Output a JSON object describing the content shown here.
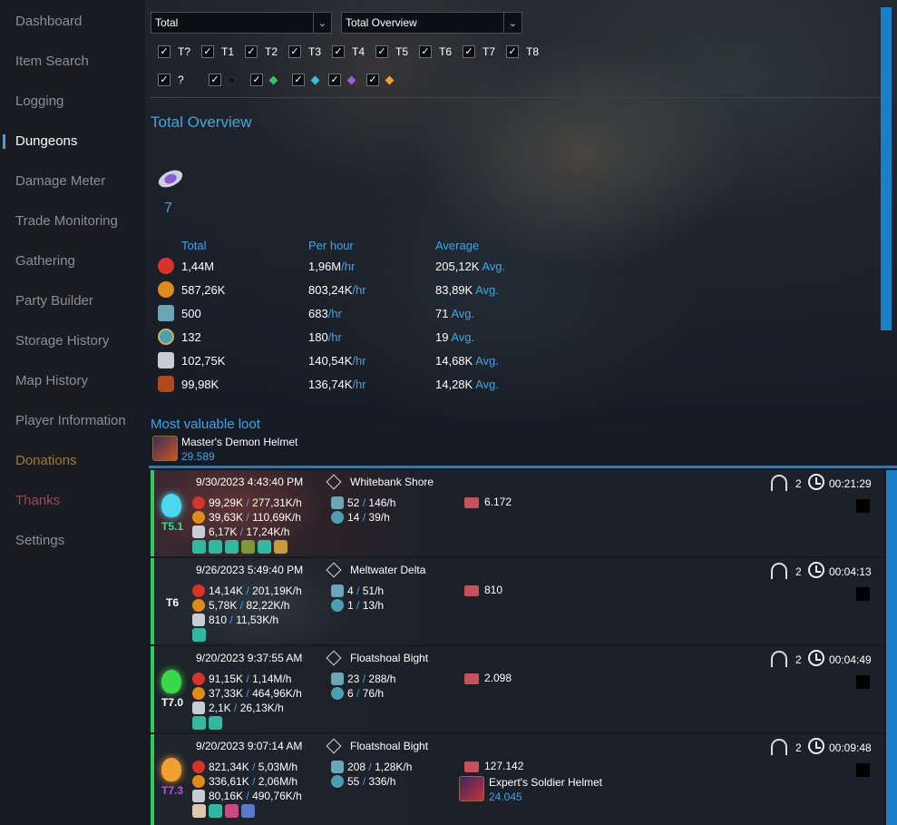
{
  "sidebar": {
    "items": [
      {
        "label": "Dashboard"
      },
      {
        "label": "Item Search"
      },
      {
        "label": "Logging"
      },
      {
        "label": "Dungeons"
      },
      {
        "label": "Damage Meter"
      },
      {
        "label": "Trade Monitoring"
      },
      {
        "label": "Gathering"
      },
      {
        "label": "Party Builder"
      },
      {
        "label": "Storage History"
      },
      {
        "label": "Map History"
      },
      {
        "label": "Player Information"
      },
      {
        "label": "Donations"
      },
      {
        "label": "Thanks"
      },
      {
        "label": "Settings"
      }
    ],
    "active": "Dungeons"
  },
  "filters": {
    "mode_select": "Total",
    "view_select": "Total Overview",
    "tiers": [
      {
        "label": "T?",
        "checked": true
      },
      {
        "label": "T1",
        "checked": true
      },
      {
        "label": "T2",
        "checked": true
      },
      {
        "label": "T3",
        "checked": true
      },
      {
        "label": "T4",
        "checked": true
      },
      {
        "label": "T5",
        "checked": true
      },
      {
        "label": "T6",
        "checked": true
      },
      {
        "label": "T7",
        "checked": true
      },
      {
        "label": "T8",
        "checked": true
      }
    ],
    "levels": [
      {
        "label": "?",
        "checked": true
      },
      {
        "icon": "black-gem-icon",
        "color": "#111111",
        "checked": true
      },
      {
        "icon": "green-gem-icon",
        "color": "#2ecc5a",
        "checked": true
      },
      {
        "icon": "cyan-gem-icon",
        "color": "#2ec8d8",
        "checked": true
      },
      {
        "icon": "purple-gem-icon",
        "color": "#a05ad8",
        "checked": true
      },
      {
        "icon": "orange-gem-icon",
        "color": "#f0a030",
        "checked": true
      }
    ],
    "check_mark": "✓"
  },
  "overview": {
    "title": "Total Overview",
    "dungeon_count": "7",
    "headers": {
      "total": "Total",
      "per_hour": "Per hour",
      "average": "Average"
    },
    "rows": [
      {
        "icon": "fame-icon",
        "color": "#d8332a",
        "total": "1,44M",
        "per_hour": "1,96M",
        "per_hour_unit": "/hr",
        "average": "205,12K",
        "avg_unit": "Avg."
      },
      {
        "icon": "respec-icon",
        "color": "#e08a1a",
        "total": "587,26K",
        "per_hour": "803,24K",
        "per_hour_unit": "/hr",
        "average": "83,89K",
        "avg_unit": "Avg."
      },
      {
        "icon": "faction-icon",
        "color": "#6aa6b8",
        "total": "500",
        "per_hour": "683",
        "per_hour_unit": "/hr",
        "average": "71",
        "avg_unit": "Avg."
      },
      {
        "icon": "might-icon",
        "color": "#4aa0b0",
        "total": "132",
        "per_hour": "180",
        "per_hour_unit": "/hr",
        "average": "19",
        "avg_unit": "Avg."
      },
      {
        "icon": "silver-icon",
        "color": "#c8ccd4",
        "total": "102,75K",
        "per_hour": "140,54K",
        "per_hour_unit": "/hr",
        "average": "14,68K",
        "avg_unit": "Avg."
      },
      {
        "icon": "mob-kill-icon",
        "color": "#b0481e",
        "total": "99,98K",
        "per_hour": "136,74K",
        "per_hour_unit": "/hr",
        "average": "14,28K",
        "avg_unit": "Avg."
      }
    ]
  },
  "loot": {
    "title": "Most valuable loot",
    "item_name": "Master's Demon Helmet",
    "item_value": "29.589"
  },
  "dungeons": [
    {
      "date": "9/30/2023 4:43:40 PM",
      "map": "Whitebank Shore",
      "tier": "T5.1",
      "tier_color": "#34e08a",
      "stripe": "#2ecc5a",
      "gem_color": "#4ad8f0",
      "fame": "99,29K",
      "fame_hr": "277,31K/h",
      "respec": "39,63K",
      "respec_hr": "110,69K/h",
      "silver": "6,17K",
      "silver_hr": "17,24K/h",
      "faction": "52",
      "faction_hr": "146/h",
      "might": "14",
      "might_hr": "39/h",
      "chest_value": "6.172",
      "players": "2",
      "duration": "00:21:29",
      "loot_name": "",
      "loot_value": "",
      "items": [
        "#33b8a0",
        "#33b8a0",
        "#33b8a0",
        "#7a9a3a",
        "#33b8a0",
        "#c89a3a"
      ]
    },
    {
      "date": "9/26/2023 5:49:40 PM",
      "map": "Meltwater Delta",
      "tier": "T6",
      "tier_color": "#ffffff",
      "stripe": "#2ecc5a",
      "gem_color": "",
      "fame": "14,14K",
      "fame_hr": "201,19K/h",
      "respec": "5,78K",
      "respec_hr": "82,22K/h",
      "silver": "810",
      "silver_hr": "11,53K/h",
      "faction": "4",
      "faction_hr": "51/h",
      "might": "1",
      "might_hr": "13/h",
      "chest_value": "810",
      "players": "2",
      "duration": "00:04:13",
      "loot_name": "",
      "loot_value": "",
      "items": [
        "#33b8a0"
      ]
    },
    {
      "date": "9/20/2023 9:37:55 AM",
      "map": "Floatshoal Bight",
      "tier": "T7.0",
      "tier_color": "#ffffff",
      "stripe": "#2ecc5a",
      "gem_color": "#3ad84a",
      "fame": "91,15K",
      "fame_hr": "1,14M/h",
      "respec": "37,33K",
      "respec_hr": "464,96K/h",
      "silver": "2,1K",
      "silver_hr": "26,13K/h",
      "faction": "23",
      "faction_hr": "288/h",
      "might": "6",
      "might_hr": "76/h",
      "chest_value": "2.098",
      "players": "2",
      "duration": "00:04:49",
      "loot_name": "",
      "loot_value": "",
      "items": [
        "#33b8a0",
        "#33b8a0"
      ]
    },
    {
      "date": "9/20/2023 9:07:14 AM",
      "map": "Floatshoal Bight",
      "tier": "T7.3",
      "tier_color": "#c050e8",
      "stripe": "#2ecc5a",
      "gem_color": "#f0a030",
      "fame": "821,34K",
      "fame_hr": "5,03M/h",
      "respec": "336,61K",
      "respec_hr": "2,06M/h",
      "silver": "80,16K",
      "silver_hr": "490,76K/h",
      "faction": "208",
      "faction_hr": "1,28K/h",
      "might": "55",
      "might_hr": "336/h",
      "chest_value": "127.142",
      "players": "2",
      "duration": "00:09:48",
      "loot_name": "Expert's Soldier Helmet",
      "loot_value": "24.045",
      "items": [
        "#d8c8b0",
        "#33b8a0",
        "#c84880",
        "#5a7ac8"
      ]
    }
  ],
  "colors": {
    "accent": "#3ba6e6",
    "scrollbar": "#1b7fc7",
    "card_stripe": "#2ecc5a"
  }
}
